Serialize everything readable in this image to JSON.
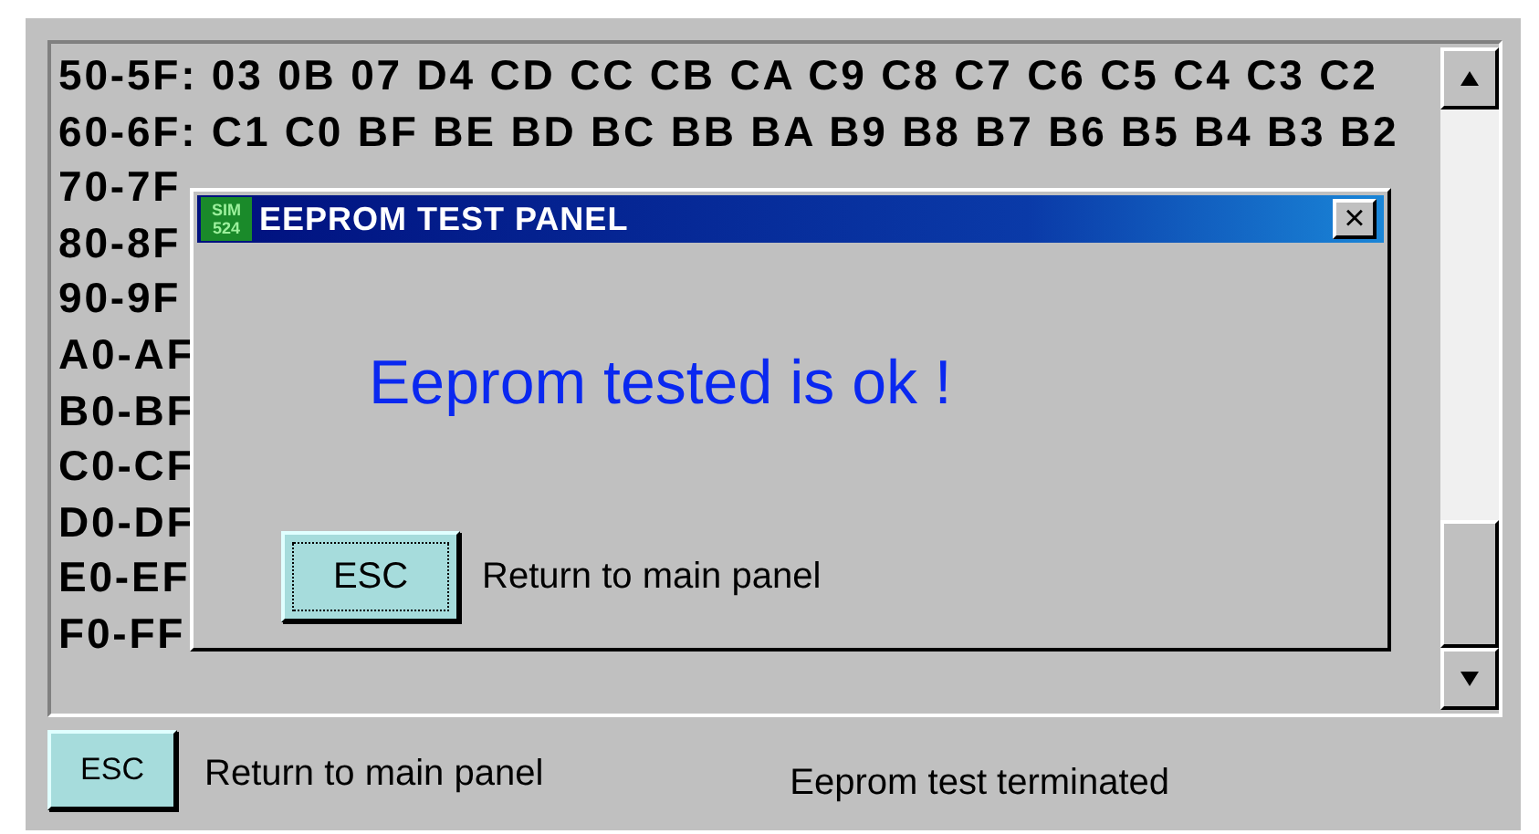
{
  "dump_rows": [
    {
      "text": "50-5F: 03 0B 07 D4 CD CC CB CA C9 C8 C7 C6 C5 C4 C3 C2"
    },
    {
      "text": "60-6F: C1 C0 BF BE BD BC BB BA B9 B8 B7 B6 B5 B4 B3 B2"
    },
    {
      "text": "70-7F"
    },
    {
      "text": "80-8F"
    },
    {
      "text": "90-9F"
    },
    {
      "text": "A0-AF"
    },
    {
      "text": "B0-BF"
    },
    {
      "text": "C0-CF"
    },
    {
      "text": "D0-DF"
    },
    {
      "text": "E0-EF"
    },
    {
      "text": "F0-FF"
    }
  ],
  "dialog": {
    "logo": [
      "SIM",
      "524"
    ],
    "title": "EEPROM TEST PANEL",
    "close": "×",
    "message": "Eeprom tested is ok !",
    "button": {
      "label": "ESC",
      "focused": true
    },
    "button_caption": "Return to main panel"
  },
  "footer": {
    "button": {
      "label": "ESC",
      "focused": false
    },
    "button_caption": "Return to main panel",
    "status": "Eeprom test terminated"
  }
}
